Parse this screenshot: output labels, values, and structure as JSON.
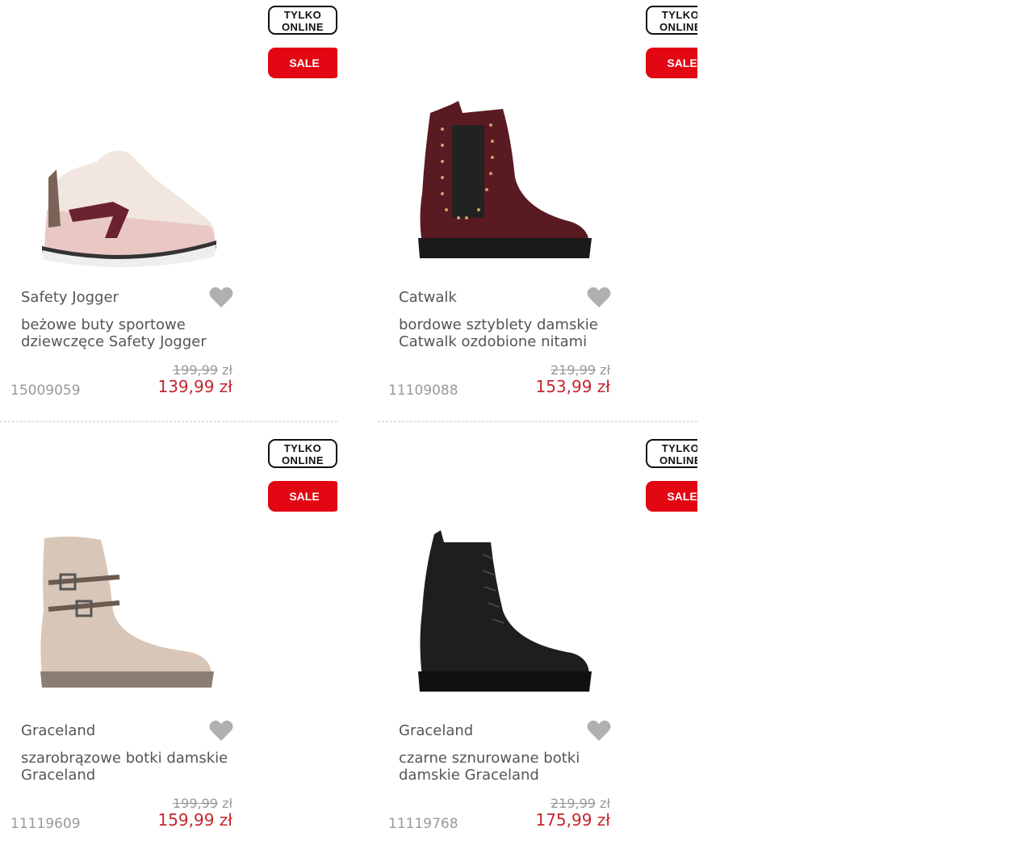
{
  "badges": {
    "online_line1": "TYLKO",
    "online_line2": "ONLINE",
    "sale": "SALE"
  },
  "currency": "zł",
  "products": [
    {
      "brand": "Safety Jogger",
      "name": "beżowe buty sportowe dziewczęce Safety Jogger",
      "old_price": "199,99",
      "price": "139,99 zł",
      "sku": "15009059",
      "image_icon": "sneaker-icon"
    },
    {
      "brand": "Catwalk",
      "name": "bordowe sztyblety damskie Catwalk ozdobione nitami",
      "old_price": "219,99",
      "price": "153,99 zł",
      "sku": "11109088",
      "image_icon": "chelsea-boot-icon"
    },
    {
      "brand": "Graceland",
      "name": "szarobrązowe botki damskie Graceland",
      "old_price": "199,99",
      "price": "159,99 zł",
      "sku": "11119609",
      "image_icon": "buckle-boot-icon"
    },
    {
      "brand": "Graceland",
      "name": "czarne sznurowane botki damskie Graceland",
      "old_price": "219,99",
      "price": "175,99 zł",
      "sku": "11119768",
      "image_icon": "lace-up-boot-icon"
    }
  ]
}
